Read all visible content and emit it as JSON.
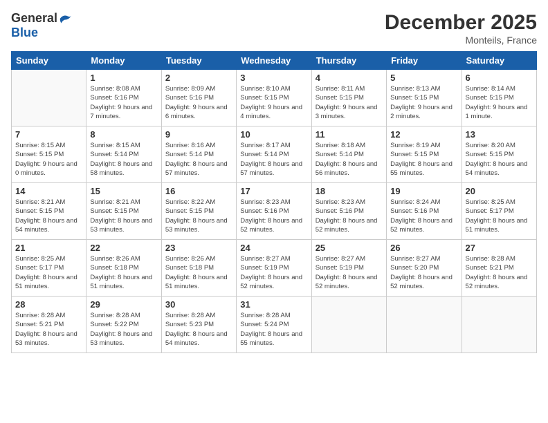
{
  "header": {
    "logo_general": "General",
    "logo_blue": "Blue",
    "month_year": "December 2025",
    "location": "Monteils, France"
  },
  "days_of_week": [
    "Sunday",
    "Monday",
    "Tuesday",
    "Wednesday",
    "Thursday",
    "Friday",
    "Saturday"
  ],
  "weeks": [
    [
      {
        "date": "",
        "sunrise": "",
        "sunset": "",
        "daylight": ""
      },
      {
        "date": "1",
        "sunrise": "Sunrise: 8:08 AM",
        "sunset": "Sunset: 5:16 PM",
        "daylight": "Daylight: 9 hours and 7 minutes."
      },
      {
        "date": "2",
        "sunrise": "Sunrise: 8:09 AM",
        "sunset": "Sunset: 5:16 PM",
        "daylight": "Daylight: 9 hours and 6 minutes."
      },
      {
        "date": "3",
        "sunrise": "Sunrise: 8:10 AM",
        "sunset": "Sunset: 5:15 PM",
        "daylight": "Daylight: 9 hours and 4 minutes."
      },
      {
        "date": "4",
        "sunrise": "Sunrise: 8:11 AM",
        "sunset": "Sunset: 5:15 PM",
        "daylight": "Daylight: 9 hours and 3 minutes."
      },
      {
        "date": "5",
        "sunrise": "Sunrise: 8:13 AM",
        "sunset": "Sunset: 5:15 PM",
        "daylight": "Daylight: 9 hours and 2 minutes."
      },
      {
        "date": "6",
        "sunrise": "Sunrise: 8:14 AM",
        "sunset": "Sunset: 5:15 PM",
        "daylight": "Daylight: 9 hours and 1 minute."
      }
    ],
    [
      {
        "date": "7",
        "sunrise": "Sunrise: 8:15 AM",
        "sunset": "Sunset: 5:15 PM",
        "daylight": "Daylight: 9 hours and 0 minutes."
      },
      {
        "date": "8",
        "sunrise": "Sunrise: 8:15 AM",
        "sunset": "Sunset: 5:14 PM",
        "daylight": "Daylight: 8 hours and 58 minutes."
      },
      {
        "date": "9",
        "sunrise": "Sunrise: 8:16 AM",
        "sunset": "Sunset: 5:14 PM",
        "daylight": "Daylight: 8 hours and 57 minutes."
      },
      {
        "date": "10",
        "sunrise": "Sunrise: 8:17 AM",
        "sunset": "Sunset: 5:14 PM",
        "daylight": "Daylight: 8 hours and 57 minutes."
      },
      {
        "date": "11",
        "sunrise": "Sunrise: 8:18 AM",
        "sunset": "Sunset: 5:14 PM",
        "daylight": "Daylight: 8 hours and 56 minutes."
      },
      {
        "date": "12",
        "sunrise": "Sunrise: 8:19 AM",
        "sunset": "Sunset: 5:15 PM",
        "daylight": "Daylight: 8 hours and 55 minutes."
      },
      {
        "date": "13",
        "sunrise": "Sunrise: 8:20 AM",
        "sunset": "Sunset: 5:15 PM",
        "daylight": "Daylight: 8 hours and 54 minutes."
      }
    ],
    [
      {
        "date": "14",
        "sunrise": "Sunrise: 8:21 AM",
        "sunset": "Sunset: 5:15 PM",
        "daylight": "Daylight: 8 hours and 54 minutes."
      },
      {
        "date": "15",
        "sunrise": "Sunrise: 8:21 AM",
        "sunset": "Sunset: 5:15 PM",
        "daylight": "Daylight: 8 hours and 53 minutes."
      },
      {
        "date": "16",
        "sunrise": "Sunrise: 8:22 AM",
        "sunset": "Sunset: 5:15 PM",
        "daylight": "Daylight: 8 hours and 53 minutes."
      },
      {
        "date": "17",
        "sunrise": "Sunrise: 8:23 AM",
        "sunset": "Sunset: 5:16 PM",
        "daylight": "Daylight: 8 hours and 52 minutes."
      },
      {
        "date": "18",
        "sunrise": "Sunrise: 8:23 AM",
        "sunset": "Sunset: 5:16 PM",
        "daylight": "Daylight: 8 hours and 52 minutes."
      },
      {
        "date": "19",
        "sunrise": "Sunrise: 8:24 AM",
        "sunset": "Sunset: 5:16 PM",
        "daylight": "Daylight: 8 hours and 52 minutes."
      },
      {
        "date": "20",
        "sunrise": "Sunrise: 8:25 AM",
        "sunset": "Sunset: 5:17 PM",
        "daylight": "Daylight: 8 hours and 51 minutes."
      }
    ],
    [
      {
        "date": "21",
        "sunrise": "Sunrise: 8:25 AM",
        "sunset": "Sunset: 5:17 PM",
        "daylight": "Daylight: 8 hours and 51 minutes."
      },
      {
        "date": "22",
        "sunrise": "Sunrise: 8:26 AM",
        "sunset": "Sunset: 5:18 PM",
        "daylight": "Daylight: 8 hours and 51 minutes."
      },
      {
        "date": "23",
        "sunrise": "Sunrise: 8:26 AM",
        "sunset": "Sunset: 5:18 PM",
        "daylight": "Daylight: 8 hours and 51 minutes."
      },
      {
        "date": "24",
        "sunrise": "Sunrise: 8:27 AM",
        "sunset": "Sunset: 5:19 PM",
        "daylight": "Daylight: 8 hours and 52 minutes."
      },
      {
        "date": "25",
        "sunrise": "Sunrise: 8:27 AM",
        "sunset": "Sunset: 5:19 PM",
        "daylight": "Daylight: 8 hours and 52 minutes."
      },
      {
        "date": "26",
        "sunrise": "Sunrise: 8:27 AM",
        "sunset": "Sunset: 5:20 PM",
        "daylight": "Daylight: 8 hours and 52 minutes."
      },
      {
        "date": "27",
        "sunrise": "Sunrise: 8:28 AM",
        "sunset": "Sunset: 5:21 PM",
        "daylight": "Daylight: 8 hours and 52 minutes."
      }
    ],
    [
      {
        "date": "28",
        "sunrise": "Sunrise: 8:28 AM",
        "sunset": "Sunset: 5:21 PM",
        "daylight": "Daylight: 8 hours and 53 minutes."
      },
      {
        "date": "29",
        "sunrise": "Sunrise: 8:28 AM",
        "sunset": "Sunset: 5:22 PM",
        "daylight": "Daylight: 8 hours and 53 minutes."
      },
      {
        "date": "30",
        "sunrise": "Sunrise: 8:28 AM",
        "sunset": "Sunset: 5:23 PM",
        "daylight": "Daylight: 8 hours and 54 minutes."
      },
      {
        "date": "31",
        "sunrise": "Sunrise: 8:28 AM",
        "sunset": "Sunset: 5:24 PM",
        "daylight": "Daylight: 8 hours and 55 minutes."
      },
      {
        "date": "",
        "sunrise": "",
        "sunset": "",
        "daylight": ""
      },
      {
        "date": "",
        "sunrise": "",
        "sunset": "",
        "daylight": ""
      },
      {
        "date": "",
        "sunrise": "",
        "sunset": "",
        "daylight": ""
      }
    ]
  ]
}
